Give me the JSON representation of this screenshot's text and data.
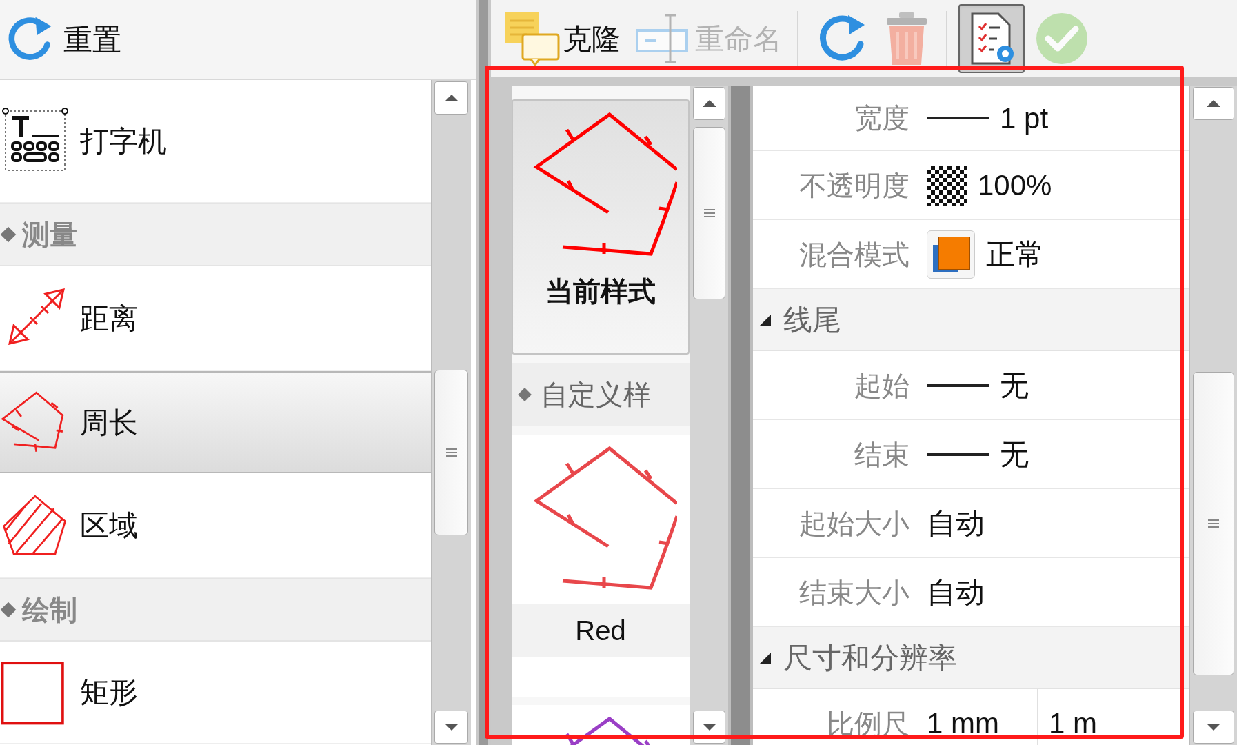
{
  "left_toolbar": {
    "reset_button": "重置"
  },
  "toolbar": [
    {
      "kind": "clone",
      "label": "克隆",
      "disabled": false,
      "pressed": false
    },
    {
      "kind": "rename",
      "label": "重命名",
      "disabled": true,
      "pressed": false
    },
    {
      "kind": "redo",
      "disabled": false,
      "pressed": false
    },
    {
      "kind": "delete",
      "disabled": true,
      "pressed": false
    },
    {
      "kind": "properties",
      "disabled": false,
      "pressed": true
    },
    {
      "kind": "apply",
      "disabled": true,
      "pressed": false
    }
  ],
  "tool_list": [
    {
      "kind": "tool",
      "label": "打字机",
      "selected": false
    },
    {
      "kind": "category",
      "label": "测量"
    },
    {
      "kind": "tool",
      "label": "距离",
      "selected": false
    },
    {
      "kind": "tool",
      "label": "周长",
      "selected": true
    },
    {
      "kind": "tool",
      "label": "区域",
      "selected": false
    },
    {
      "kind": "category",
      "label": "绘制"
    },
    {
      "kind": "tool",
      "label": "矩形",
      "selected": false
    }
  ],
  "style_list": [
    {
      "kind": "style",
      "label": "当前样式",
      "selected": true,
      "color": "#ff0000"
    },
    {
      "kind": "category",
      "label": "自定义样"
    },
    {
      "kind": "style",
      "label": "Red",
      "selected": false,
      "color": "#e8474b"
    },
    {
      "kind": "style",
      "selected": false,
      "color": "#9a3fc6"
    }
  ],
  "properties": [
    {
      "kind": "line",
      "label": "宽度",
      "value": "1 pt"
    },
    {
      "kind": "checker",
      "label": "不透明度",
      "value": "100%"
    },
    {
      "kind": "blend",
      "label": "混合模式",
      "value": "正常"
    },
    {
      "kind": "section",
      "label": "线尾",
      "expanded": true
    },
    {
      "kind": "line",
      "label": "起始",
      "value": "无"
    },
    {
      "kind": "line",
      "label": "结束",
      "value": "无"
    },
    {
      "kind": "text",
      "label": "起始大小",
      "value": "自动"
    },
    {
      "kind": "text",
      "label": "结束大小",
      "value": "自动"
    },
    {
      "kind": "section",
      "label": "尺寸和分辨率",
      "expanded": true
    },
    {
      "kind": "scale",
      "label": "比例尺",
      "value": "1 mm",
      "value_2": "1 m"
    }
  ]
}
